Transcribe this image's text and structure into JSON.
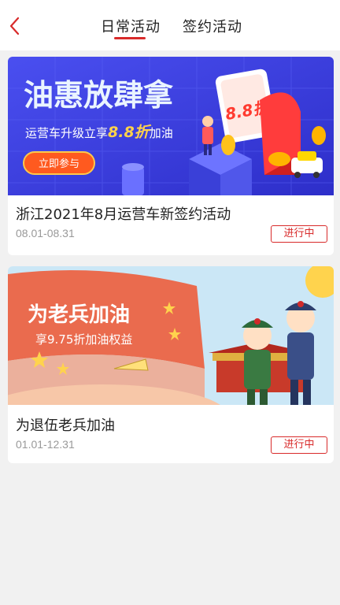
{
  "header": {
    "tabs": [
      {
        "label": "日常活动",
        "active": true
      },
      {
        "label": "签约活动",
        "active": false
      }
    ]
  },
  "colors": {
    "accent": "#d82a2a",
    "banner1_bg": "#3b3fe0",
    "banner2_sky": "#cbe7f6"
  },
  "activities": [
    {
      "title": "浙江2021年8月运营车新签约活动",
      "date": "08.01-08.31",
      "status": "进行中",
      "banner": {
        "headline": "油惠放肆拿",
        "subline_pre": "运营车升级立享",
        "subline_hl": "8.8折",
        "subline_post": "加油",
        "cta": "立即参与",
        "badge": "8.8折"
      }
    },
    {
      "title": "为退伍老兵加油",
      "date": "01.01-12.31",
      "status": "进行中",
      "banner": {
        "headline": "为老兵加油",
        "subline": "享9.75折加油权益"
      }
    }
  ]
}
